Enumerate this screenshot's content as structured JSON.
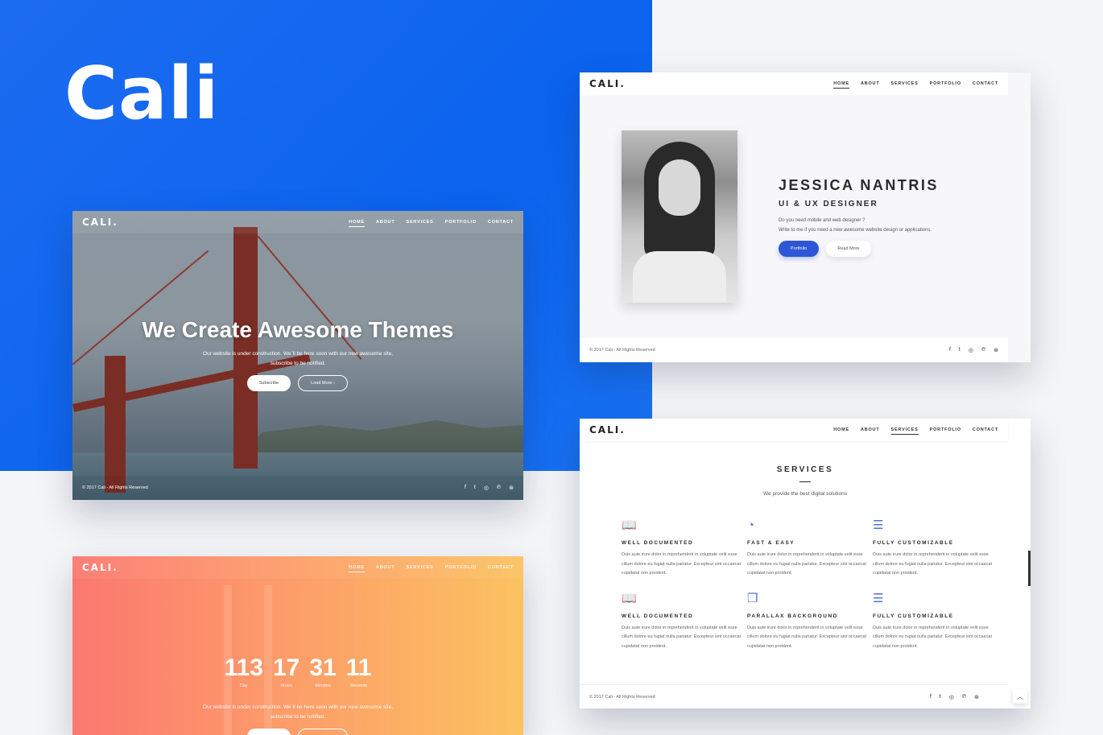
{
  "brand": {
    "title": "Cali"
  },
  "hero": {
    "nav": {
      "logo": "CALI.",
      "links": [
        "HOME",
        "ABOUT",
        "SERVICES",
        "PORTFOLIO",
        "CONTACT"
      ]
    },
    "title": "We Create Awesome Themes",
    "subtitle_line1": "Our website is under construction. We`ll be here soon with our new awesome site,",
    "subtitle_line2": "subscribe to be notified.",
    "subscribe_label": "Subscribe",
    "load_more_label": "Load More  ›",
    "copyright": "© 2017 Cali - All Rights Reserved",
    "socials": [
      "f",
      "t",
      "◎",
      "℗",
      "⊛"
    ]
  },
  "countdown": {
    "nav": {
      "logo": "CALI.",
      "links": [
        "HOME",
        "ABOUT",
        "SERVICES",
        "PORTFOLIO",
        "CONTACT"
      ]
    },
    "counters": [
      {
        "num": "113",
        "label": "Day"
      },
      {
        "num": "17",
        "label": "Hours"
      },
      {
        "num": "31",
        "label": "Minutes"
      },
      {
        "num": "11",
        "label": "Seconds"
      }
    ],
    "subtitle_line1": "Our website is under construction. We`ll be here soon with our new awesome site,",
    "subtitle_line2": "subscribe to be notified."
  },
  "profile": {
    "nav": {
      "logo": "CALI.",
      "links": [
        "HOME",
        "ABOUT",
        "SERVICES",
        "PORTFOLIO",
        "CONTACT"
      ]
    },
    "name": "JESSICA NANTRIS",
    "role": "UI & UX DESIGNER",
    "desc_line1": "Do you need mobile and web designer ?",
    "desc_line2": "Write to me if you need a new awesome website design or applications.",
    "portfolio_label": "Portfolio",
    "read_more_label": "Read More",
    "copyright": "© 2017 Cali - All Rights Reserved",
    "socials": [
      "f",
      "t",
      "◎",
      "℗",
      "⊛"
    ]
  },
  "services": {
    "nav": {
      "logo": "CALI.",
      "links": [
        "HOME",
        "ABOUT",
        "SERVICES",
        "PORTFOLIO",
        "CONTACT"
      ]
    },
    "title": "SERVICES",
    "subtitle": "We provide the best digital solutions",
    "items": [
      {
        "icon": "📖",
        "title": "WELL DOCUMENTED",
        "text": "Duis aute irure dolor in reprehenderit in voluptate velit esse cillum dolore eu fugiat nulla pariatur. Excepteur sint occaecat cupidatat non proident."
      },
      {
        "icon": "◔",
        "title": "FAST & EASY",
        "text": "Duis aute irure dolor in reprehenderit in voluptate velit esse cillum dolore eu fugiat nulla pariatur. Excepteur sint occaecat cupidatat non proident."
      },
      {
        "icon": "☰",
        "title": "FULLY CUSTOMIZABLE",
        "text": "Duis aute irure dolor in reprehenderit in voluptate velit esse cillum dolore eu fugiat nulla pariatur. Excepteur sint occaecat cupidatat non proident."
      },
      {
        "icon": "📖",
        "title": "WELL DOCUMENTED",
        "text": "Duis aute irure dolor in reprehenderit in voluptate velit esse cillum dolore eu fugiat nulla pariatur. Excepteur sint occaecat cupidatat non proident."
      },
      {
        "icon": "❐",
        "title": "PARALLAX BACKGROUND",
        "text": "Duis aute irure dolor in reprehenderit in voluptate velit esse cillum dolore eu fugiat nulla pariatur. Excepteur sint occaecat cupidatat non proident."
      },
      {
        "icon": "☰",
        "title": "FULLY CUSTOMIZABLE",
        "text": "Duis aute irure dolor in reprehenderit in voluptate velit esse cillum dolore eu fugiat nulla pariatur. Excepteur sint occaecat cupidatat non proident."
      }
    ],
    "copyright": "© 2017 Cali - All Rights Reserved",
    "socials": [
      "f",
      "t",
      "◎",
      "℗",
      "⊛"
    ],
    "to_top": "︿"
  },
  "colors": {
    "brand_blue": "#1a6cf0",
    "accent_blue": "#2e56d7",
    "countdown_from": "#fb7870",
    "countdown_to": "#fbc260"
  }
}
